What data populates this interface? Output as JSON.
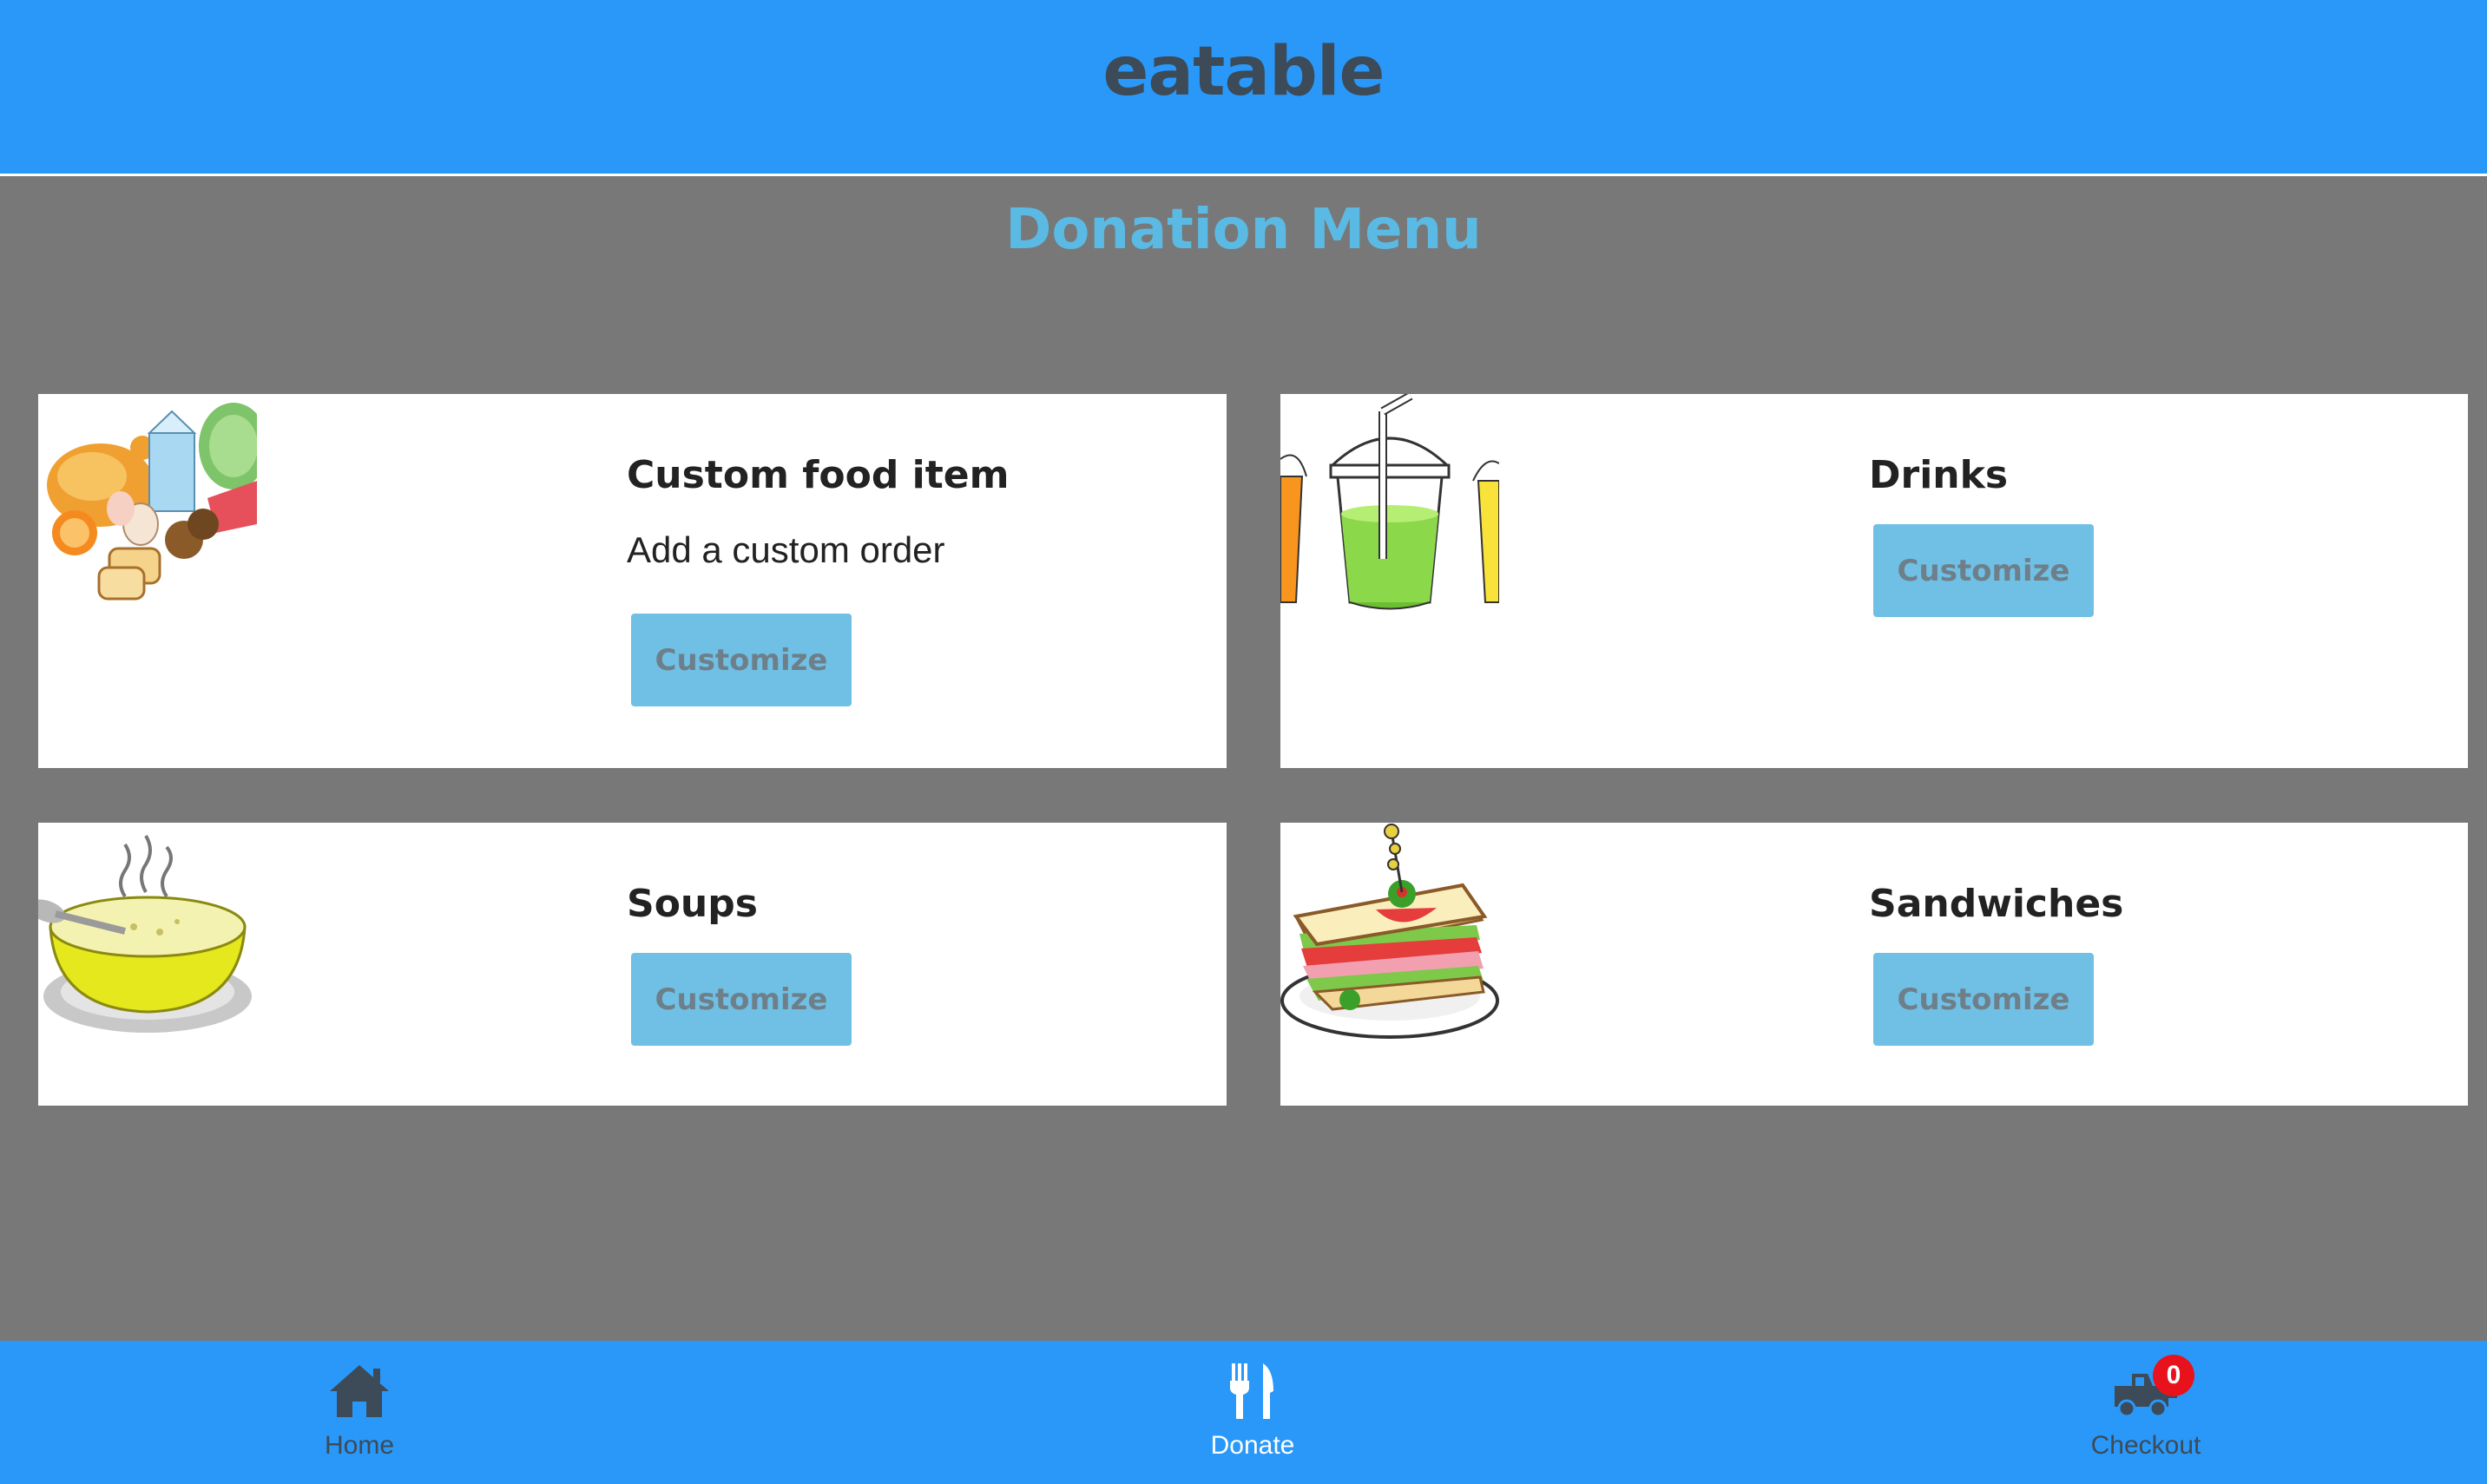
{
  "header": {
    "title": "eatable"
  },
  "page": {
    "heading": "Donation Menu"
  },
  "cards": [
    {
      "title": "Custom food item",
      "description": "Add a custom order",
      "button": "Customize",
      "image_icon": "groceries-icon"
    },
    {
      "title": "Drinks",
      "button": "Customize",
      "image_icon": "drinks-icon"
    },
    {
      "title": "Soups",
      "button": "Customize",
      "image_icon": "soup-bowl-icon"
    },
    {
      "title": "Sandwiches",
      "button": "Customize",
      "image_icon": "sandwich-icon"
    }
  ],
  "nav": {
    "home": {
      "label": "Home",
      "icon": "home-icon"
    },
    "donate": {
      "label": "Donate",
      "icon": "fork-knife-icon"
    },
    "checkout": {
      "label": "Checkout",
      "icon": "delivery-truck-icon",
      "badge": "0"
    }
  },
  "colors": {
    "primary": "#2998f9",
    "background": "#787878",
    "heading": "#5bbae4",
    "button": "#6fc0e4",
    "badge": "#e8121c"
  }
}
